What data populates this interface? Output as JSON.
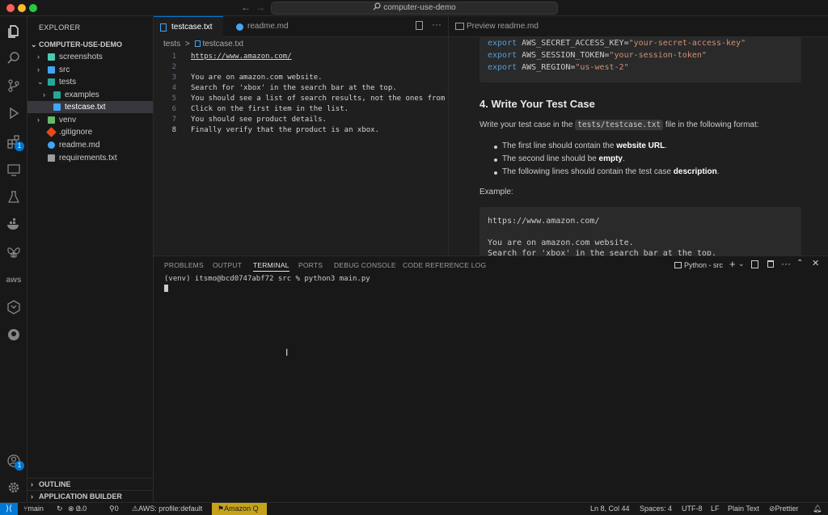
{
  "titlebar": {
    "search_text": "computer-use-demo",
    "back_icon": "arrow-left-icon",
    "forward_icon": "arrow-right-icon"
  },
  "colors": {
    "accent": "#0078d4",
    "statusbar_amazonq": "#c5a21a",
    "remote": "#0078d4"
  },
  "activity": {
    "items": [
      "files-icon",
      "search-icon",
      "source-control-icon",
      "run-debug-icon",
      "extensions-icon",
      "remote-explorer-icon",
      "testing-icon",
      "docker-icon",
      "butterfly-icon",
      "aws-icon",
      "hexagon-icon",
      "github-icon",
      "account-icon",
      "settings-gear-icon"
    ],
    "extensions_badge": "1",
    "account_badge": "1",
    "aws_label": "aws"
  },
  "explorer": {
    "header": "EXPLORER",
    "root": "COMPUTER-USE-DEMO",
    "items": [
      {
        "label": "screenshots"
      },
      {
        "label": "src"
      },
      {
        "label": "tests"
      },
      {
        "label": "examples"
      },
      {
        "label": "testcase.txt"
      },
      {
        "label": "venv"
      },
      {
        "label": ".gitignore"
      },
      {
        "label": "readme.md"
      },
      {
        "label": "requirements.txt"
      }
    ],
    "outline": "OUTLINE",
    "app_builder": "APPLICATION BUILDER"
  },
  "editor": {
    "tabs": [
      {
        "label": "testcase.txt"
      },
      {
        "label": "readme.md"
      }
    ],
    "breadcrumb": {
      "folder": "tests",
      "sep": ">",
      "file": "testcase.txt"
    },
    "lines": [
      {
        "n": "1",
        "t": "https://www.amazon.com/"
      },
      {
        "n": "2",
        "t": ""
      },
      {
        "n": "3",
        "t": "You are on amazon.com website."
      },
      {
        "n": "4",
        "t": "Search for 'xbox' in the search bar at the top."
      },
      {
        "n": "5",
        "t": "You should see a list of search results, not the ones from the"
      },
      {
        "n": "6",
        "t": "Click on the first item in the list."
      },
      {
        "n": "7",
        "t": "You should see product details."
      },
      {
        "n": "8",
        "t": "Finally verify that the product is an xbox."
      }
    ]
  },
  "preview": {
    "tab": "Preview readme.md",
    "code1": [
      {
        "kw": "export",
        "name": " AWS_SECRET_ACCESS_KEY=",
        "val": "\"your-secret-access-key\""
      },
      {
        "kw": "export",
        "name": " AWS_SESSION_TOKEN=",
        "val": "\"your-session-token\""
      },
      {
        "kw": "export",
        "name": " AWS_REGION=",
        "val": "\"us-west-2\""
      }
    ],
    "heading": "4. Write Your Test Case",
    "para_pre": "Write your test case in the ",
    "para_code": "tests/testcase.txt",
    "para_post": " file in the following format:",
    "bullets": [
      {
        "pre": "The first line should contain the ",
        "bold": "website URL",
        "post": "."
      },
      {
        "pre": "The second line should be ",
        "bold": "empty",
        "post": "."
      },
      {
        "pre": "The following lines should contain the test case ",
        "bold": "description",
        "post": "."
      }
    ],
    "example_label": "Example:",
    "code2": [
      "https://www.amazon.com/",
      "",
      "You are on amazon.com website.",
      "Search for 'xbox' in the search bar at the top."
    ]
  },
  "panel": {
    "tabs": [
      "PROBLEMS",
      "OUTPUT",
      "TERMINAL",
      "PORTS",
      "DEBUG CONSOLE",
      "CODE REFERENCE LOG"
    ],
    "terminal_name": "Python - src",
    "prompt": "(venv) itsmo@bcd0747abf72 src % python3 main.py"
  },
  "statusbar": {
    "branch": "main",
    "errors": "0",
    "warnings": "0",
    "ports": "0",
    "aws": "AWS: profile:default",
    "amazonq": "Amazon Q",
    "position": "Ln 8, Col 44",
    "spaces": "Spaces: 4",
    "encoding": "UTF-8",
    "eol": "LF",
    "language": "Plain Text",
    "prettier": "Prettier"
  }
}
